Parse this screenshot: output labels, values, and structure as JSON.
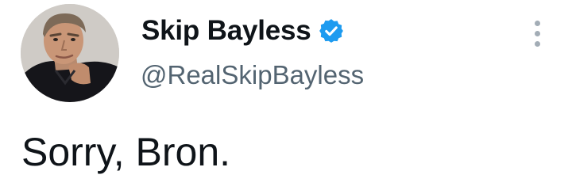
{
  "tweet": {
    "author": {
      "display_name": "Skip Bayless",
      "handle": "@RealSkipBayless",
      "verified": true,
      "avatar_icon": "profile-photo",
      "verified_icon": "verified-badge-icon"
    },
    "text": "Sorry, Bron.",
    "more_icon": "more-options-icon"
  },
  "colors": {
    "name": "#0f1419",
    "handle": "#536471",
    "verified_badge": "#1d9bf0",
    "more_dots": "#a3adb6",
    "background": "#ffffff"
  }
}
